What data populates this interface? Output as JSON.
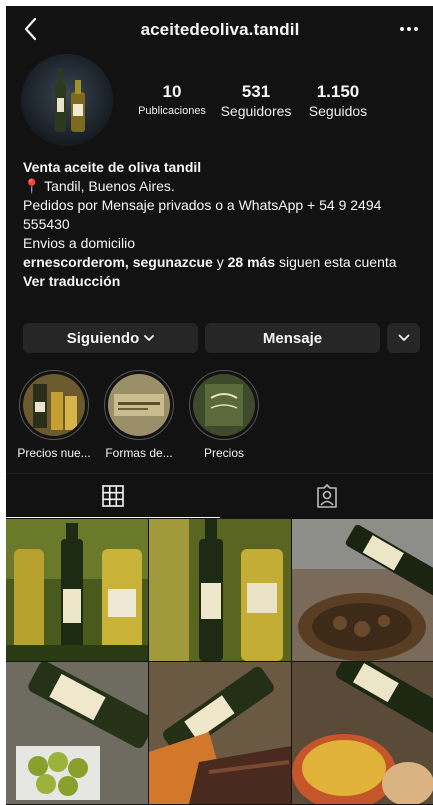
{
  "header": {
    "back_icon": "chevron-left-icon",
    "username": "aceitedeoliva.tandil",
    "more_icon": "ellipsis-icon"
  },
  "stats": [
    {
      "value": "10",
      "label": "Publicaciones"
    },
    {
      "value": "531",
      "label": "Seguidores"
    },
    {
      "value": "1.150",
      "label": "Seguidos"
    }
  ],
  "bio": {
    "name": "Venta aceite de oliva tandil",
    "location": "📍 Tandil, Buenos Aires.",
    "orders": "Pedidos por Mensaje privados o a WhatsApp + 54 9 2494 555430",
    "delivery": "Envios a domicilio",
    "followed_by_names": "ernescorderom, segunazcue",
    "followed_by_and": "y",
    "followed_by_more": "28 más",
    "followed_by_suffix": "siguen esta cuenta",
    "translate": "Ver traducción"
  },
  "actions": {
    "following": "Siguiendo",
    "message": "Mensaje"
  },
  "highlights": [
    {
      "label": "Precios nue..."
    },
    {
      "label": "Formas de..."
    },
    {
      "label": "Precios"
    }
  ],
  "tabs": {
    "grid_icon": "grid-icon",
    "tagged_icon": "tagged-person-icon"
  },
  "colors": {
    "background": "#121212",
    "button": "#262626",
    "text": "#f5f5f5"
  }
}
